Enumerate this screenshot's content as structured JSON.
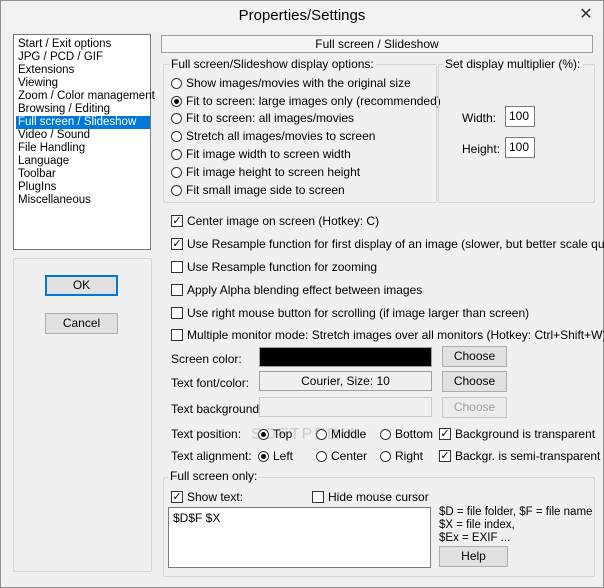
{
  "window": {
    "title": "Properties/Settings",
    "close_glyph": "✕"
  },
  "categories": [
    {
      "label": "Start / Exit options",
      "selected": false
    },
    {
      "label": "JPG / PCD / GIF",
      "selected": false
    },
    {
      "label": "Extensions",
      "selected": false
    },
    {
      "label": "Viewing",
      "selected": false
    },
    {
      "label": "Zoom / Color management",
      "selected": false
    },
    {
      "label": "Browsing / Editing",
      "selected": false
    },
    {
      "label": "Full screen / Slideshow",
      "selected": true
    },
    {
      "label": "Video / Sound",
      "selected": false
    },
    {
      "label": "File Handling",
      "selected": false
    },
    {
      "label": "Language",
      "selected": false
    },
    {
      "label": "Toolbar",
      "selected": false
    },
    {
      "label": "PlugIns",
      "selected": false
    },
    {
      "label": "Miscellaneous",
      "selected": false
    }
  ],
  "buttons": {
    "ok": "OK",
    "cancel": "Cancel",
    "choose": "Choose",
    "help": "Help"
  },
  "page_header": "Full screen / Slideshow",
  "display_options": {
    "title": "Full screen/Slideshow display options:",
    "options": [
      {
        "label": "Show images/movies with the original size",
        "checked": false
      },
      {
        "label": "Fit to screen: large images only (recommended)",
        "checked": true
      },
      {
        "label": "Fit to screen: all images/movies",
        "checked": false
      },
      {
        "label": "Stretch all images/movies to screen",
        "checked": false
      },
      {
        "label": "Fit image width to screen width",
        "checked": false
      },
      {
        "label": "Fit image height to screen height",
        "checked": false
      },
      {
        "label": "Fit small image side to screen",
        "checked": false
      }
    ]
  },
  "multiplier": {
    "title": "Set display multiplier (%):",
    "width_label": "Width:",
    "width_value": "100",
    "height_label": "Height:",
    "height_value": "100"
  },
  "checkboxes": [
    {
      "label": "Center image on screen (Hotkey: C)",
      "checked": true
    },
    {
      "label": "Use Resample function for first display of an image (slower, but better scale quality)",
      "checked": true
    },
    {
      "label": "Use Resample function for zooming",
      "checked": false
    },
    {
      "label": "Apply Alpha blending effect between images",
      "checked": false
    },
    {
      "label": "Use right mouse button for scrolling (if image larger than screen)",
      "checked": false
    },
    {
      "label": "Multiple monitor mode: Stretch images over all monitors (Hotkey: Ctrl+Shift+W)",
      "checked": false
    }
  ],
  "screen_color": {
    "label": "Screen color:",
    "color": "#000000"
  },
  "text_font": {
    "label": "Text font/color:",
    "value": "Courier, Size: 10"
  },
  "text_background": {
    "label": "Text background:"
  },
  "text_position": {
    "label": "Text position:",
    "options": [
      {
        "label": "Top",
        "checked": true
      },
      {
        "label": "Middle",
        "checked": false
      },
      {
        "label": "Bottom",
        "checked": false
      }
    ],
    "extra_check": {
      "label": "Background is transparent",
      "checked": true
    }
  },
  "text_alignment": {
    "label": "Text alignment:",
    "options": [
      {
        "label": "Left",
        "checked": true
      },
      {
        "label": "Center",
        "checked": false
      },
      {
        "label": "Right",
        "checked": false
      }
    ],
    "extra_check": {
      "label": "Backgr. is semi-transparent",
      "checked": true
    }
  },
  "full_screen_only": {
    "title": "Full screen only:",
    "show_text": {
      "label": "Show text:",
      "checked": true
    },
    "hide_cursor": {
      "label": "Hide mouse cursor",
      "checked": false
    },
    "text_value": "$D$F $X",
    "help_lines": [
      "$D = file folder, $F = file name",
      "$X = file index,",
      "$Ex = EXIF ..."
    ]
  },
  "watermark": "SOFTPEDIA"
}
